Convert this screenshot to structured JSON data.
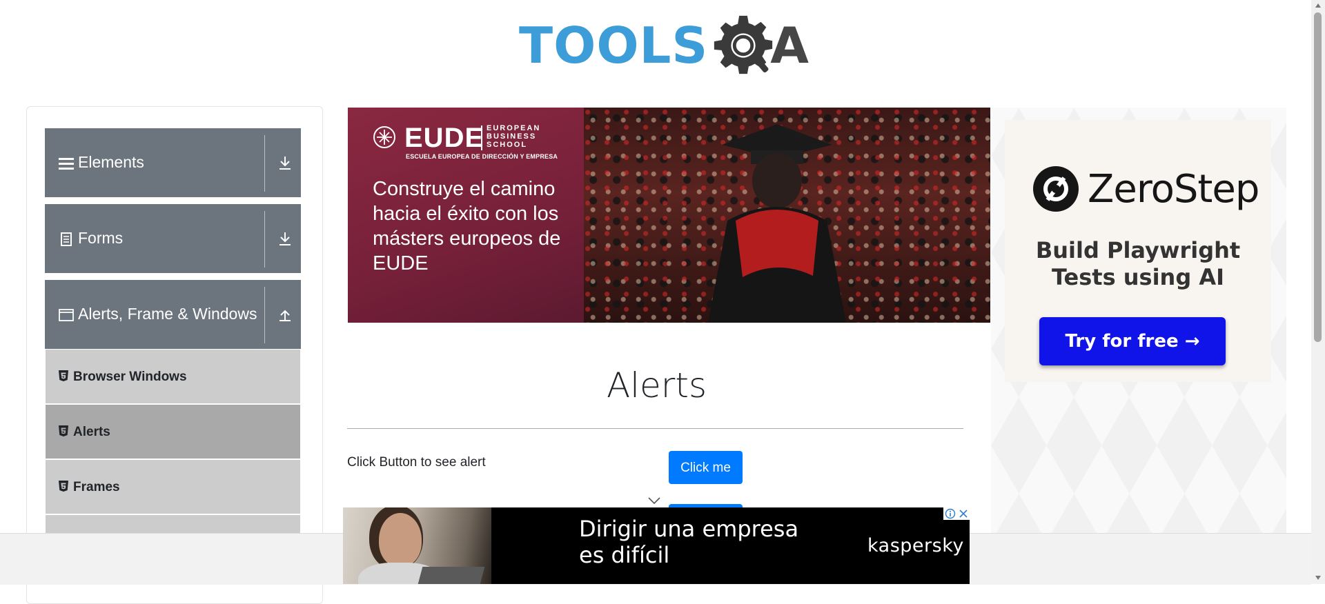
{
  "header": {
    "logo_text": "TOOLSQA",
    "logo_tools": "TOOLS",
    "logo_a": "A"
  },
  "sidebar": {
    "groups": [
      {
        "label": "Elements",
        "icon": "hamburger-icon",
        "toggle_icon": "download-arrow-icon"
      },
      {
        "label": "Forms",
        "icon": "document-icon",
        "toggle_icon": "download-arrow-icon"
      },
      {
        "label": "Alerts, Frame & Windows",
        "icon": "window-icon",
        "toggle_icon": "upload-arrow-icon"
      }
    ],
    "items": [
      {
        "label": "Browser Windows",
        "icon": "html5-shield-icon",
        "active": false
      },
      {
        "label": "Alerts",
        "icon": "html5-shield-icon",
        "active": true
      },
      {
        "label": "Frames",
        "icon": "html5-shield-icon",
        "active": false
      }
    ]
  },
  "top_ad": {
    "brand": "EUDE",
    "brand_tagline": "EUROPEAN\nBUSINESS\nSCHOOL",
    "brand_sub": "ESCUELA EUROPEA DE DIRECCIÓN Y EMPRESA",
    "headline": "Construye el camino hacia el éxito con los másters europeos de EUDE"
  },
  "main": {
    "title": "Alerts",
    "rows": [
      {
        "label": "Click Button to see alert",
        "button": "Click me"
      }
    ]
  },
  "right_ad": {
    "brand": "ZeroStep",
    "tagline": "Build Playwright Tests using AI",
    "cta": "Try for free →",
    "accent": "#1014e8"
  },
  "bottom_ad": {
    "headline": "Dirigir una empresa\nes difícil",
    "brand": "kaspersky"
  },
  "colors": {
    "sidebar_header": "#6c757d",
    "sidebar_item": "#cccccc",
    "sidebar_item_active": "#a9a9a9",
    "primary_button": "#007bff",
    "logo_blue": "#3c9dd8"
  }
}
